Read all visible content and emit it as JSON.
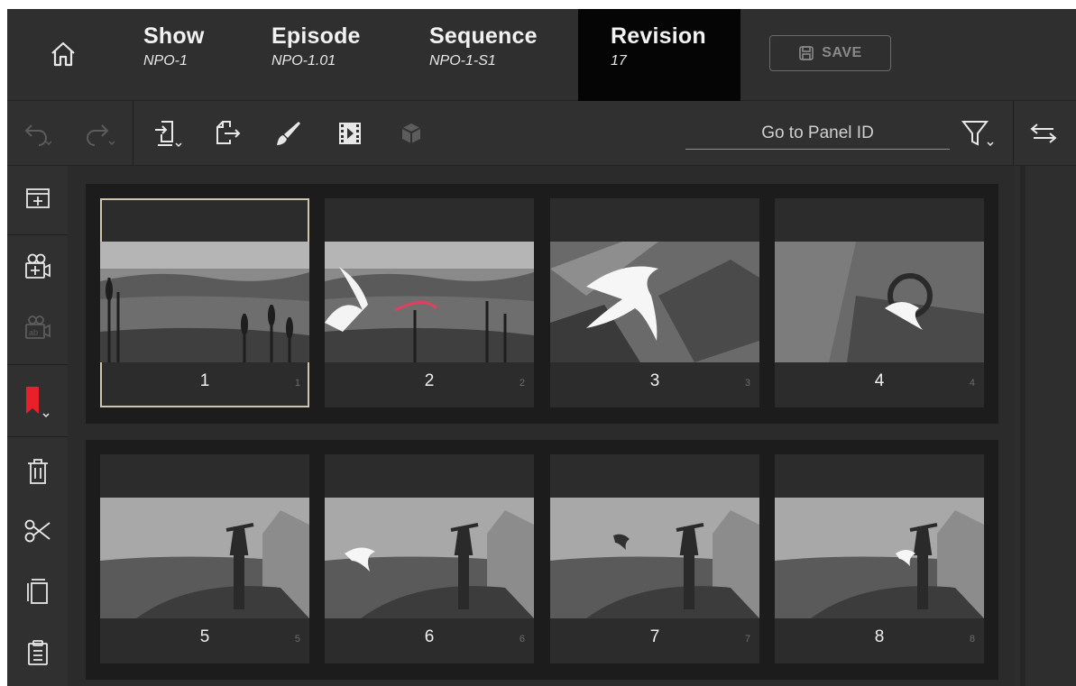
{
  "header": {
    "home_icon": "home-icon",
    "breadcrumbs": [
      {
        "label": "Show",
        "value": "NPO-1"
      },
      {
        "label": "Episode",
        "value": "NPO-1.01"
      },
      {
        "label": "Sequence",
        "value": "NPO-1-S1"
      },
      {
        "label": "Revision",
        "value": "17"
      }
    ],
    "save_label": "SAVE"
  },
  "toolbar": {
    "goto_placeholder": "Go to Panel ID",
    "icons": [
      "undo-icon",
      "redo-icon",
      "import-icon",
      "export-icon",
      "brush-icon",
      "film-icon",
      "cube-icon",
      "filter-icon",
      "swap-icon"
    ]
  },
  "sidebar": {
    "icons": [
      "add-panel-icon",
      "add-camera-icon",
      "camera-label-icon",
      "bookmark-icon",
      "trash-icon",
      "scissors-icon",
      "copy-icon",
      "paste-icon"
    ]
  },
  "colors": {
    "bookmark": "#e8202a",
    "selection": "#cdc6ad",
    "revision_bg": "#050505"
  },
  "panels": [
    {
      "number": "1",
      "index": "1",
      "selected": true
    },
    {
      "number": "2",
      "index": "2"
    },
    {
      "number": "3",
      "index": "3"
    },
    {
      "number": "4",
      "index": "4"
    },
    {
      "number": "5",
      "index": "5"
    },
    {
      "number": "6",
      "index": "6"
    },
    {
      "number": "7",
      "index": "7"
    },
    {
      "number": "8",
      "index": "8"
    }
  ]
}
